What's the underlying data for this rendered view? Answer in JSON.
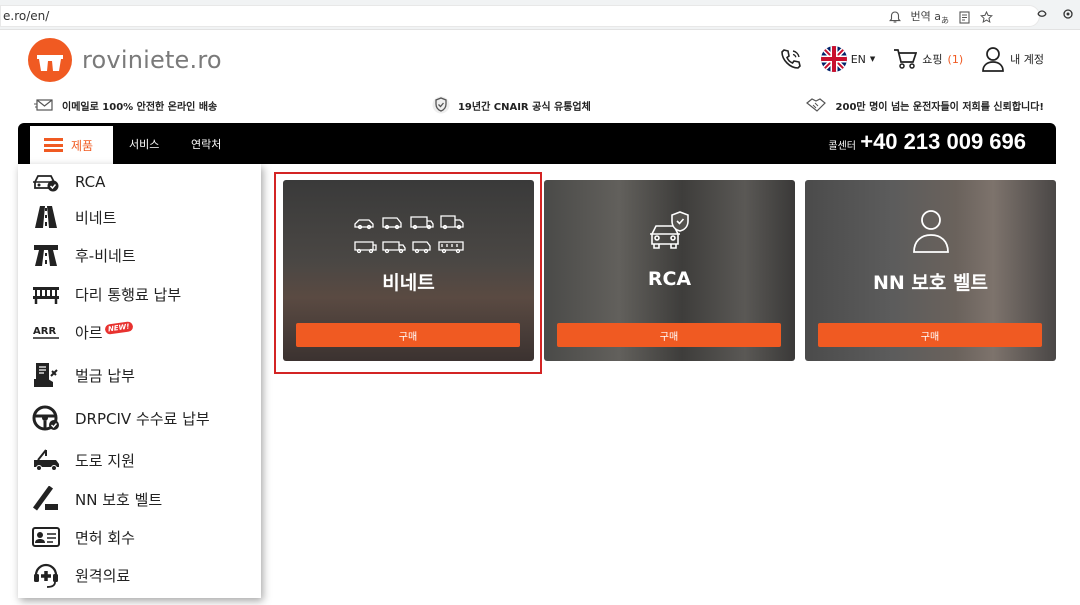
{
  "browser": {
    "url": "e.ro/en/",
    "translate_label": "번역"
  },
  "header": {
    "logo_text": "roviniete.ro",
    "lang": "EN",
    "cart_label": "쇼핑",
    "cart_count": "(1)",
    "account_label": "내 계정"
  },
  "strip": {
    "items": [
      "이메일로 100% 안전한 온라인 배송",
      "19년간 CNAIR 공식 유통업체",
      "200만 명이 넘는 운전자들이 저희를 신뢰합니다!"
    ]
  },
  "nav": {
    "products": "제품",
    "services": "서비스",
    "contact": "연락처",
    "callcenter": "콜센터",
    "phone": "+40 213 009 696"
  },
  "dropdown": {
    "items": [
      {
        "label": "RCA",
        "icon": "car-check-icon"
      },
      {
        "label": "비네트",
        "icon": "road-icon"
      },
      {
        "label": "후-비네트",
        "icon": "highway-icon"
      },
      {
        "label": "다리 통행료 납부",
        "icon": "bridge-icon"
      },
      {
        "label": "아르",
        "icon": "arr-icon",
        "badge": "NEW!"
      },
      {
        "label": "벌금 납부",
        "icon": "fine-icon"
      },
      {
        "label": "DRPCIV 수수료 납부",
        "icon": "steering-wheel-icon"
      },
      {
        "label": "도로 지원",
        "icon": "tow-truck-icon"
      },
      {
        "label": "NN 보호 벨트",
        "icon": "seatbelt-icon"
      },
      {
        "label": "면허 회수",
        "icon": "license-card-icon"
      },
      {
        "label": "원격의료",
        "icon": "telemedicine-icon"
      }
    ]
  },
  "cards": [
    {
      "title": "비네트",
      "buy": "구매"
    },
    {
      "title": "RCA",
      "buy": "구매"
    },
    {
      "title": "NN 보호 벨트",
      "buy": "구매"
    }
  ],
  "colors": {
    "accent": "#f05a22",
    "nav_bg": "#000000",
    "highlight": "#d32424"
  }
}
